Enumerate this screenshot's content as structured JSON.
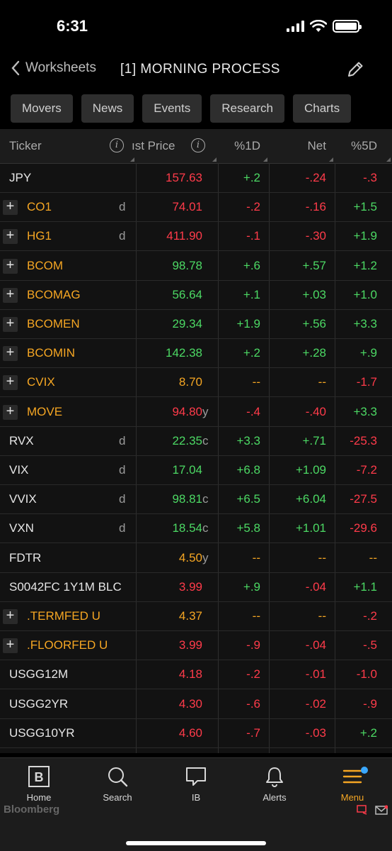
{
  "status": {
    "time": "6:31"
  },
  "nav": {
    "back_label": "Worksheets",
    "title": "[1] MORNING PROCESS"
  },
  "tabs": [
    "Movers",
    "News",
    "Events",
    "Research",
    "Charts"
  ],
  "columns": {
    "ticker": "Ticker",
    "last_price": "ıst Price",
    "pct1d": "%1D",
    "net": "Net",
    "pct5d": "%5D"
  },
  "rows": [
    {
      "ticker": "JPY",
      "expand": false,
      "ticker_color": "white",
      "flag": "",
      "price": "157.63",
      "price_color": "red",
      "suffix": "",
      "d1": "+.2",
      "d1_color": "green",
      "net": "-.24",
      "net_color": "red",
      "d5": "-.3",
      "d5_color": "red"
    },
    {
      "ticker": "CO1",
      "expand": true,
      "ticker_color": "orange",
      "flag": "d",
      "price": "74.01",
      "price_color": "red",
      "suffix": "",
      "d1": "-.2",
      "d1_color": "red",
      "net": "-.16",
      "net_color": "red",
      "d5": "+1.5",
      "d5_color": "green"
    },
    {
      "ticker": "HG1",
      "expand": true,
      "ticker_color": "orange",
      "flag": "d",
      "price": "411.90",
      "price_color": "red",
      "suffix": "",
      "d1": "-.1",
      "d1_color": "red",
      "net": "-.30",
      "net_color": "red",
      "d5": "+1.9",
      "d5_color": "green"
    },
    {
      "ticker": "BCOM",
      "expand": true,
      "ticker_color": "orange",
      "flag": "",
      "price": "98.78",
      "price_color": "green",
      "suffix": "",
      "d1": "+.6",
      "d1_color": "green",
      "net": "+.57",
      "net_color": "green",
      "d5": "+1.2",
      "d5_color": "green"
    },
    {
      "ticker": "BCOMAG",
      "expand": true,
      "ticker_color": "orange",
      "flag": "",
      "price": "56.64",
      "price_color": "green",
      "suffix": "",
      "d1": "+.1",
      "d1_color": "green",
      "net": "+.03",
      "net_color": "green",
      "d5": "+1.0",
      "d5_color": "green"
    },
    {
      "ticker": "BCOMEN",
      "expand": true,
      "ticker_color": "orange",
      "flag": "",
      "price": "29.34",
      "price_color": "green",
      "suffix": "",
      "d1": "+1.9",
      "d1_color": "green",
      "net": "+.56",
      "net_color": "green",
      "d5": "+3.3",
      "d5_color": "green"
    },
    {
      "ticker": "BCOMIN",
      "expand": true,
      "ticker_color": "orange",
      "flag": "",
      "price": "142.38",
      "price_color": "green",
      "suffix": "",
      "d1": "+.2",
      "d1_color": "green",
      "net": "+.28",
      "net_color": "green",
      "d5": "+.9",
      "d5_color": "green"
    },
    {
      "ticker": "CVIX",
      "expand": true,
      "ticker_color": "orange",
      "flag": "",
      "price": "8.70",
      "price_color": "orange",
      "suffix": "",
      "d1": "--",
      "d1_color": "orange",
      "net": "--",
      "net_color": "orange",
      "d5": "-1.7",
      "d5_color": "red"
    },
    {
      "ticker": "MOVE",
      "expand": true,
      "ticker_color": "orange",
      "flag": "",
      "price": "94.80",
      "price_color": "red",
      "suffix": "y",
      "d1": "-.4",
      "d1_color": "red",
      "net": "-.40",
      "net_color": "red",
      "d5": "+3.3",
      "d5_color": "green"
    },
    {
      "ticker": "RVX",
      "expand": false,
      "ticker_color": "white",
      "flag": "d",
      "price": "22.35",
      "price_color": "green",
      "suffix": "c",
      "d1": "+3.3",
      "d1_color": "green",
      "net": "+.71",
      "net_color": "green",
      "d5": "-25.3",
      "d5_color": "red"
    },
    {
      "ticker": "VIX",
      "expand": false,
      "ticker_color": "white",
      "flag": "d",
      "price": "17.04",
      "price_color": "green",
      "suffix": "",
      "d1": "+6.8",
      "d1_color": "green",
      "net": "+1.09",
      "net_color": "green",
      "d5": "-7.2",
      "d5_color": "red"
    },
    {
      "ticker": "VVIX",
      "expand": false,
      "ticker_color": "white",
      "flag": "d",
      "price": "98.81",
      "price_color": "green",
      "suffix": "c",
      "d1": "+6.5",
      "d1_color": "green",
      "net": "+6.04",
      "net_color": "green",
      "d5": "-27.5",
      "d5_color": "red"
    },
    {
      "ticker": "VXN",
      "expand": false,
      "ticker_color": "white",
      "flag": "d",
      "price": "18.54",
      "price_color": "green",
      "suffix": "c",
      "d1": "+5.8",
      "d1_color": "green",
      "net": "+1.01",
      "net_color": "green",
      "d5": "-29.6",
      "d5_color": "red"
    },
    {
      "ticker": "FDTR",
      "expand": false,
      "ticker_color": "white",
      "flag": "",
      "price": "4.50",
      "price_color": "orange",
      "suffix": "y",
      "d1": "--",
      "d1_color": "orange",
      "net": "--",
      "net_color": "orange",
      "d5": "--",
      "d5_color": "orange"
    },
    {
      "ticker": "S0042FC 1Y1M BLC",
      "expand": false,
      "ticker_color": "white",
      "flag": "",
      "price": "3.99",
      "price_color": "red",
      "suffix": "",
      "d1": "+.9",
      "d1_color": "green",
      "net": "-.04",
      "net_color": "red",
      "d5": "+1.1",
      "d5_color": "green"
    },
    {
      "ticker": ".TERMFED U",
      "expand": true,
      "ticker_color": "orange",
      "flag": "",
      "price": "4.37",
      "price_color": "orange",
      "suffix": "",
      "d1": "--",
      "d1_color": "orange",
      "net": "--",
      "net_color": "orange",
      "d5": "-.2",
      "d5_color": "red"
    },
    {
      "ticker": ".FLOORFED U",
      "expand": true,
      "ticker_color": "orange",
      "flag": "",
      "price": "3.99",
      "price_color": "red",
      "suffix": "",
      "d1": "-.9",
      "d1_color": "red",
      "net": "-.04",
      "net_color": "red",
      "d5": "-.5",
      "d5_color": "red"
    },
    {
      "ticker": "USGG12M",
      "expand": false,
      "ticker_color": "white",
      "flag": "",
      "price": "4.18",
      "price_color": "red",
      "suffix": "",
      "d1": "-.2",
      "d1_color": "red",
      "net": "-.01",
      "net_color": "red",
      "d5": "-1.0",
      "d5_color": "red"
    },
    {
      "ticker": "USGG2YR",
      "expand": false,
      "ticker_color": "white",
      "flag": "",
      "price": "4.30",
      "price_color": "red",
      "suffix": "",
      "d1": "-.6",
      "d1_color": "red",
      "net": "-.02",
      "net_color": "red",
      "d5": "-.9",
      "d5_color": "red"
    },
    {
      "ticker": "USGG10YR",
      "expand": false,
      "ticker_color": "white",
      "flag": "",
      "price": "4.60",
      "price_color": "red",
      "suffix": "",
      "d1": "-.7",
      "d1_color": "red",
      "net": "-.03",
      "net_color": "red",
      "d5": "+.2",
      "d5_color": "green"
    }
  ],
  "bottom_nav": {
    "items": [
      {
        "label": "Home",
        "icon": "bloomberg-b-icon"
      },
      {
        "label": "Search",
        "icon": "search-icon"
      },
      {
        "label": "IB",
        "icon": "chat-bubble-icon"
      },
      {
        "label": "Alerts",
        "icon": "bell-icon"
      },
      {
        "label": "Menu",
        "icon": "menu-icon"
      }
    ],
    "active": "Menu",
    "brand": "Bloomberg"
  },
  "colors": {
    "red": "#ff3b4a",
    "green": "#4cd964",
    "orange": "#f5a623",
    "background": "#000000"
  }
}
